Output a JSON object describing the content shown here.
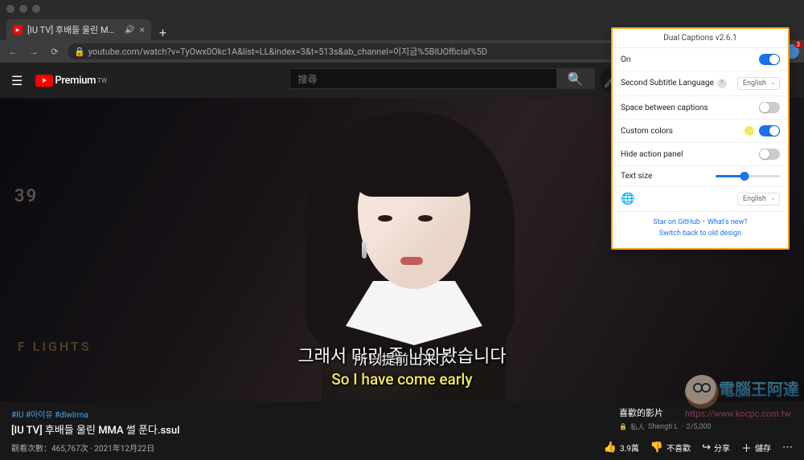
{
  "browser": {
    "tab_title": "[IU TV] 후배들 울린 MMA 썰",
    "url": "youtube.com/watch?v=TyOwx0Okc1A&list=LL&index=3&t=513s&ab_channel=이지금%5BIUOfficial%5D",
    "notification_badge": "3"
  },
  "youtube": {
    "brand": "Premium",
    "region": "TW",
    "search_placeholder": "搜尋"
  },
  "video": {
    "bg_num": "39",
    "bg_text": "F LIGHTS",
    "caption_ko": "그래서 미리 좀 나와봤습니다",
    "caption_zh": "所以提前出来了",
    "caption_en": "So I have come early",
    "hashtags": "#IU #아이유 #dlwlrma",
    "title": "[IU TV] 후배들 울린 MMA 썰 푼다.ssul",
    "views_label": "觀看次數：465,767次",
    "date": "2021年12月22日"
  },
  "actions": {
    "like_count": "3.9萬",
    "dislike_label": "不喜歡",
    "share_label": "分享",
    "save_label": "儲存"
  },
  "sidebar": {
    "heading": "喜歡的影片",
    "privacy": "私人",
    "owner": "Shengti L",
    "progress": "2/5,000"
  },
  "popup": {
    "title": "Dual Captions v2.6.1",
    "on_label": "On",
    "second_lang_label": "Second Subtitle Language",
    "second_lang_value": "English",
    "space_label": "Space between captions",
    "colors_label": "Custom colors",
    "hide_panel_label": "Hide action panel",
    "textsize_label": "Text size",
    "ui_lang_value": "English",
    "link_github": "Star on GitHub",
    "link_whatsnew": "What's new?",
    "link_old": "Switch back to old design",
    "slider_pct": 45
  },
  "watermark": {
    "text": "電腦王阿達",
    "url": "https://www.kocpc.com.tw"
  }
}
